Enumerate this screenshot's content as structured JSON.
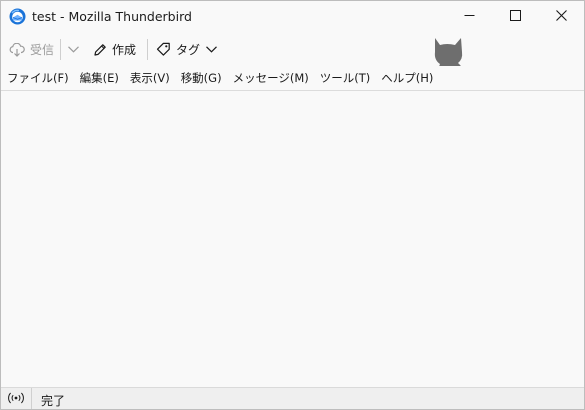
{
  "window": {
    "title": "test - Mozilla Thunderbird",
    "app_icon": "thunderbird-logo-icon",
    "controls": {
      "minimize_icon": "minimize-icon",
      "maximize_icon": "maximize-icon",
      "close_icon": "close-icon"
    }
  },
  "toolbar": {
    "get_messages_label": "受信",
    "get_messages_icon": "cloud-download-icon",
    "get_messages_dropdown_icon": "chevron-down-icon",
    "write_label": "作成",
    "write_icon": "pencil-icon",
    "tag_label": "タグ",
    "tag_icon": "tag-icon",
    "tag_dropdown_icon": "chevron-down-icon",
    "decoration_icon": "cat-silhouette-icon"
  },
  "menubar": {
    "items": [
      {
        "label": "ファイル(F)"
      },
      {
        "label": "編集(E)"
      },
      {
        "label": "表示(V)"
      },
      {
        "label": "移動(G)"
      },
      {
        "label": "メッセージ(M)"
      },
      {
        "label": "ツール(T)"
      },
      {
        "label": "ヘルプ(H)"
      }
    ]
  },
  "statusbar": {
    "online_icon": "online-status-icon",
    "status_text": "完了"
  },
  "colors": {
    "window_bg": "#f9f9f9",
    "statusbar_bg": "#efefef",
    "thunderbird_blue": "#1a73d8",
    "disabled_text": "#9a9a9a",
    "cat_gray": "#6e6e6e"
  }
}
